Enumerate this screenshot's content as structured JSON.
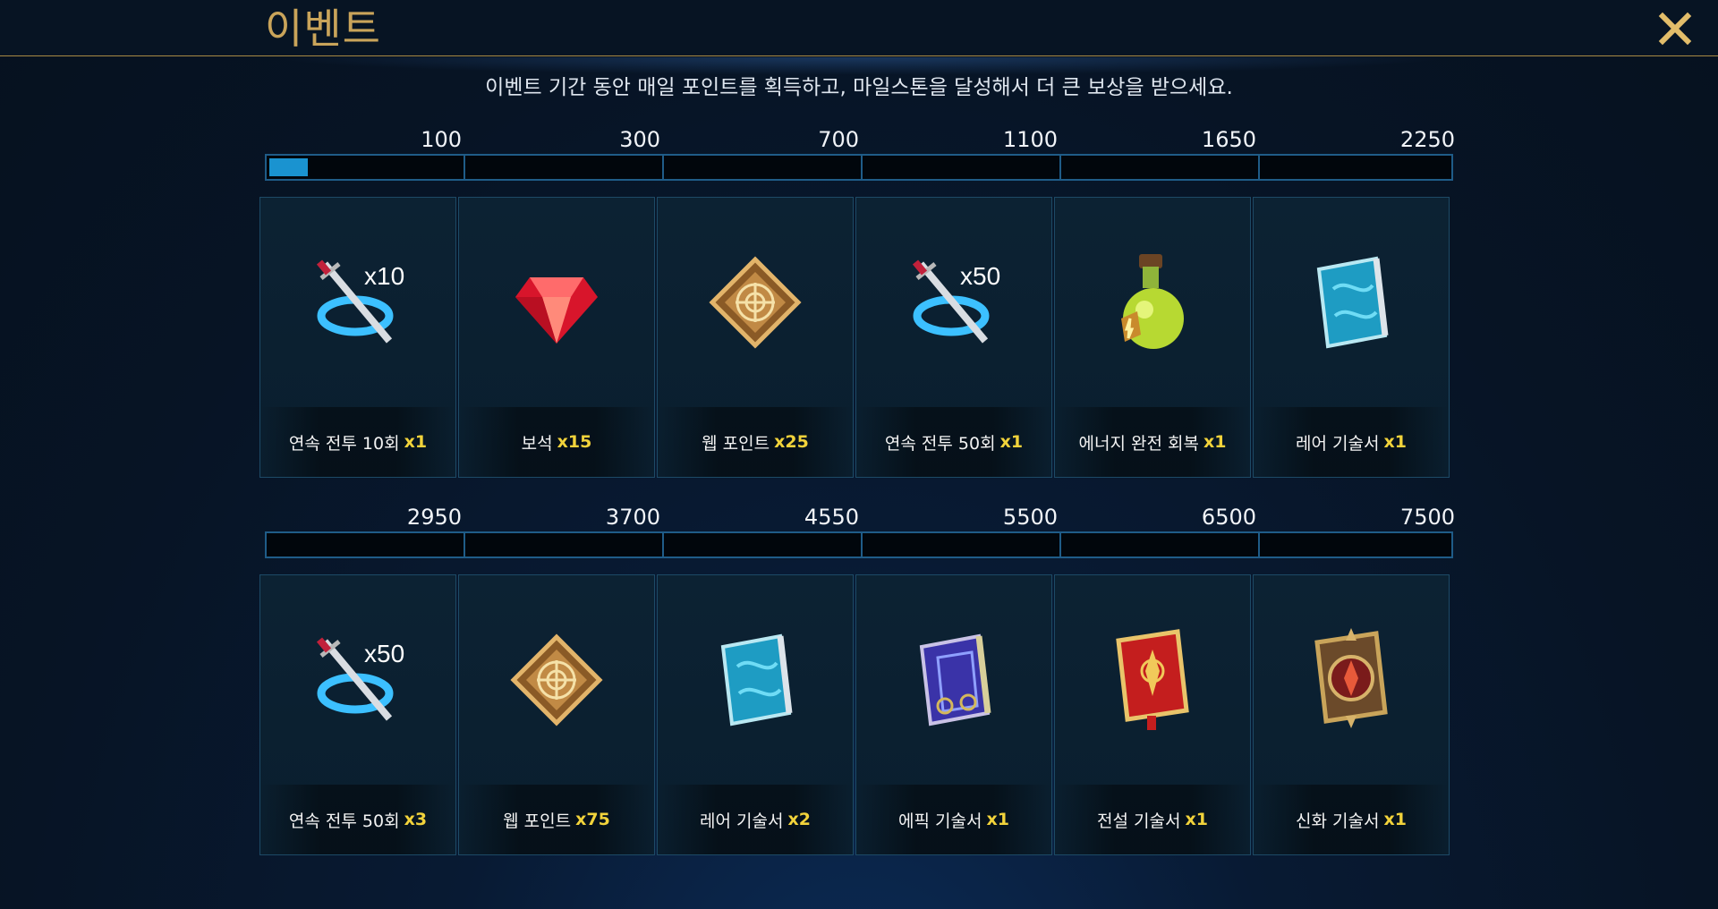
{
  "header": {
    "title": "이벤트"
  },
  "subtitle": "이벤트 기간 동안 매일 포인트를 획득하고, 마일스톤을 달성해서 더 큰 보상을 받으세요.",
  "progress": {
    "points": 25,
    "max_first_tier": 2250
  },
  "tiers": [
    {
      "milestones": [
        "100",
        "300",
        "700",
        "1100",
        "1650",
        "2250"
      ],
      "fill_fraction_first_segment": 0.2,
      "rewards": [
        {
          "name": "연속 전투 10회",
          "qty": "x1",
          "icon": "multi-battle-icon",
          "multiplier": "x10"
        },
        {
          "name": "보석",
          "qty": "x15",
          "icon": "gem-icon"
        },
        {
          "name": "웹 포인트",
          "qty": "x25",
          "icon": "web-point-icon"
        },
        {
          "name": "연속 전투 50회",
          "qty": "x1",
          "icon": "multi-battle-icon",
          "multiplier": "x50"
        },
        {
          "name": "에너지 완전 회복",
          "qty": "x1",
          "icon": "energy-potion-icon"
        },
        {
          "name": "레어 기술서",
          "qty": "x1",
          "icon": "rare-tome-icon"
        }
      ]
    },
    {
      "milestones": [
        "2950",
        "3700",
        "4550",
        "5500",
        "6500",
        "7500"
      ],
      "fill_fraction_first_segment": 0,
      "rewards": [
        {
          "name": "연속 전투 50회",
          "qty": "x3",
          "icon": "multi-battle-icon",
          "multiplier": "x50"
        },
        {
          "name": "웹 포인트",
          "qty": "x75",
          "icon": "web-point-icon"
        },
        {
          "name": "레어 기술서",
          "qty": "x2",
          "icon": "rare-tome-icon"
        },
        {
          "name": "에픽 기술서",
          "qty": "x1",
          "icon": "epic-tome-icon"
        },
        {
          "name": "전설 기술서",
          "qty": "x1",
          "icon": "legendary-tome-icon"
        },
        {
          "name": "신화 기술서",
          "qty": "x1",
          "icon": "mythical-tome-icon"
        }
      ]
    }
  ],
  "colors": {
    "accent_gold": "#c9a45a",
    "progress_fill": "#1a93d0",
    "qty_yellow": "#f2d33b",
    "card_border": "#1d4a66"
  }
}
